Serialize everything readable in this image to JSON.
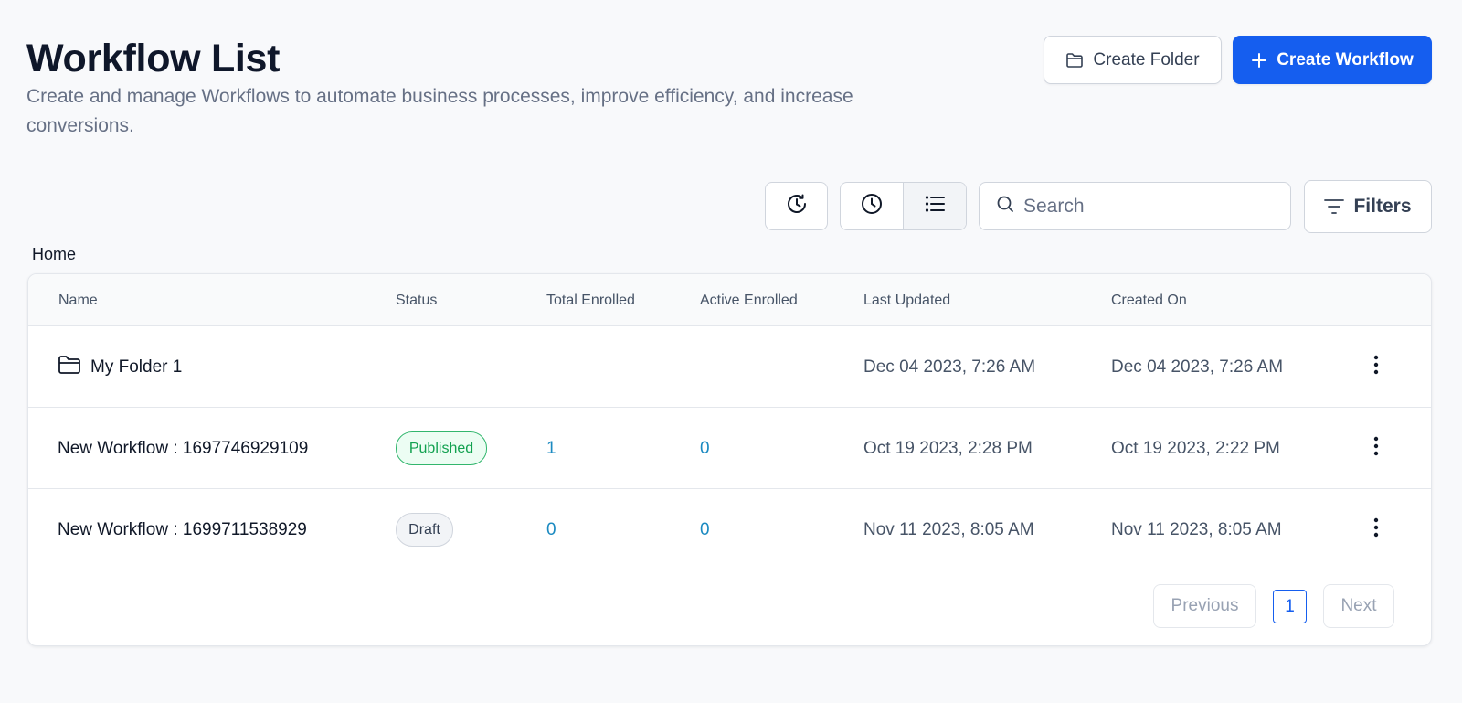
{
  "header": {
    "title": "Workflow List",
    "description": "Create and manage Workflows to automate business processes, improve efficiency, and increase conversions.",
    "create_folder_label": "Create Folder",
    "create_workflow_label": "Create Workflow"
  },
  "toolbar": {
    "search_placeholder": "Search",
    "filters_label": "Filters",
    "view_active": "list"
  },
  "breadcrumb": "Home",
  "table": {
    "columns": [
      "Name",
      "Status",
      "Total Enrolled",
      "Active Enrolled",
      "Last Updated",
      "Created On"
    ],
    "rows": [
      {
        "type": "folder",
        "name": "My Folder 1",
        "status": "",
        "total_enrolled": "",
        "active_enrolled": "",
        "last_updated": "Dec 04 2023, 7:26 AM",
        "created_on": "Dec 04 2023, 7:26 AM"
      },
      {
        "type": "workflow",
        "name": "New Workflow : 1697746929109",
        "status": "Published",
        "total_enrolled": "1",
        "active_enrolled": "0",
        "last_updated": "Oct 19 2023, 2:28 PM",
        "created_on": "Oct 19 2023, 2:22 PM"
      },
      {
        "type": "workflow",
        "name": "New Workflow : 1699711538929",
        "status": "Draft",
        "total_enrolled": "0",
        "active_enrolled": "0",
        "last_updated": "Nov 11 2023, 8:05 AM",
        "created_on": "Nov 11 2023, 8:05 AM"
      }
    ]
  },
  "pagination": {
    "previous_label": "Previous",
    "current_page": "1",
    "next_label": "Next"
  },
  "colors": {
    "primary": "#155eef",
    "published": "#12a150",
    "link_number": "#1b8ac1",
    "background": "#f8f9fb"
  }
}
